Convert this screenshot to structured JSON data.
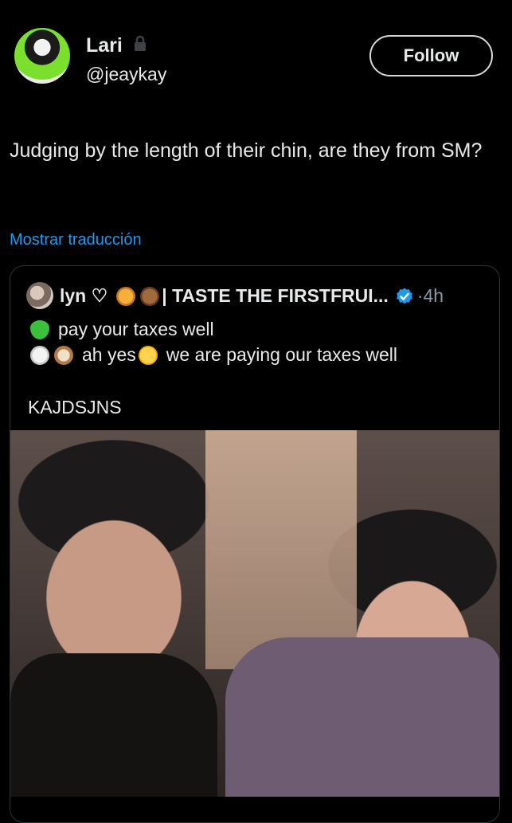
{
  "post": {
    "author_name": "Lari",
    "author_handle": "@jeaykay",
    "follow_label": "Follow",
    "text": "Judging by the length of their chin, are they from SM?",
    "translate_label": "Mostrar traducción"
  },
  "quote": {
    "author_name": "lyn ♡",
    "author_title": "| TASTE THE FIRSTFRUI...",
    "time_prefix": "·",
    "time": "4h",
    "line1": "pay your taxes well",
    "line2_a": "ah yes",
    "line2_b": "we are paying our taxes well",
    "line3": "KAJDSJNS"
  },
  "icons": {
    "lock": "lock-icon",
    "verified": "verified-badge-icon",
    "green_heart": "green-heart-emoji",
    "rabbit": "rabbit-emoji",
    "dog": "dog-emoji",
    "tiger": "tiger-emoji",
    "bear": "bear-emoji",
    "crying": "crying-emoji"
  },
  "colors": {
    "background": "#000000",
    "text": "#e7e9ea",
    "link": "#1d9bf0",
    "muted": "#8b98a5",
    "border": "#2f3336"
  }
}
